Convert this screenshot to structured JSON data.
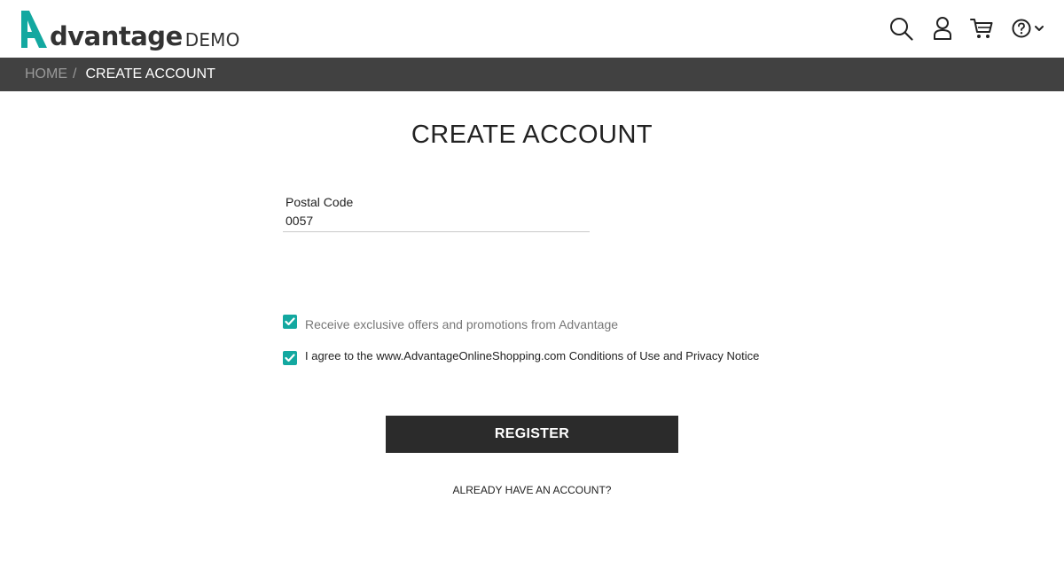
{
  "header": {
    "logo": {
      "word": "dvantage",
      "demo": "DEMO",
      "brand_color": "#13a8a0"
    },
    "icons": [
      "search-icon",
      "user-icon",
      "cart-icon",
      "help-icon",
      "chevron-down-icon"
    ]
  },
  "breadcrumb": {
    "home": "HOME",
    "separator": "/",
    "current": "CREATE ACCOUNT"
  },
  "main": {
    "title": "CREATE ACCOUNT",
    "postal_code": {
      "label": "Postal Code",
      "value": "0057"
    },
    "offers_checkbox": {
      "checked": true,
      "label": "Receive exclusive offers and promotions from Advantage"
    },
    "agree_checkbox": {
      "checked": true,
      "prefix": "I agree to the www.AdvantageOnlineShopping.com ",
      "conditions": "Conditions of Use",
      "and": " and ",
      "privacy": "Privacy Notice"
    },
    "register_label": "REGISTER",
    "already_account_label": "ALREADY HAVE AN ACCOUNT?"
  },
  "colors": {
    "accent": "#13a8a0",
    "breadcrumb_bg": "#414141",
    "button_bg": "#2b2b2b"
  }
}
